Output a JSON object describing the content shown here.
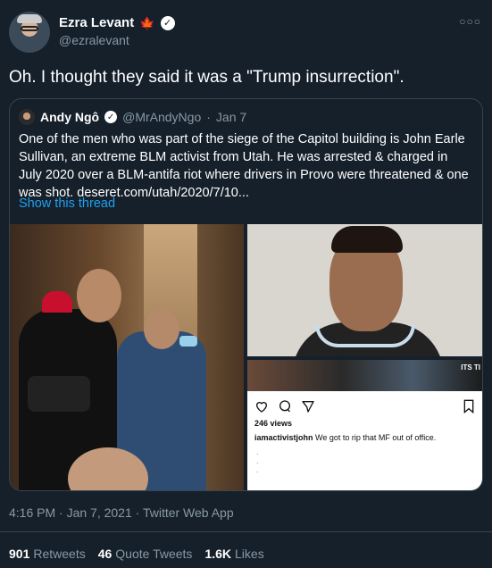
{
  "author": {
    "name": "Ezra Levant",
    "flag_icon": "maple-leaf-icon",
    "verified_icon": "verified-badge-icon",
    "handle": "@ezralevant",
    "more_icon": "more-icon"
  },
  "tweet": {
    "text": "Oh. I thought they said it was a \"Trump insurrection\"."
  },
  "quoted": {
    "name": "Andy Ngô",
    "handle": "@MrAndyNgo",
    "separator": "·",
    "date": "Jan 7",
    "body": "One of the men who was part of the siege of the Capitol building is John Earle Sullivan, an extreme BLM activist from Utah. He was arrested & charged in July 2020 over a BLM-antifa riot where drivers in Provo were threatened & one was shot. deseret.com/utah/2020/7/10...",
    "show_thread": "Show this thread",
    "instagram": {
      "strip_text": "ITS TI",
      "views": "246 views",
      "username": "iamactivistjohn",
      "caption": "We got to rip that MF out of office.",
      "dots": "."
    }
  },
  "meta": {
    "timestamp": "4:16 PM · Jan 7, 2021 · Twitter Web App"
  },
  "stats": {
    "retweets_count": "901",
    "retweets_label": "Retweets",
    "quotes_count": "46",
    "quotes_label": "Quote Tweets",
    "likes_count": "1.6K",
    "likes_label": "Likes"
  },
  "colors": {
    "background": "#15202b",
    "link": "#1da1f2",
    "muted": "#8899a6",
    "border": "#38444d"
  }
}
